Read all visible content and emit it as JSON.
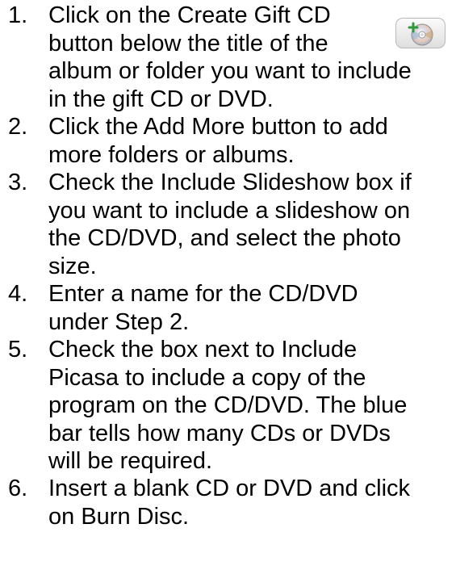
{
  "steps": [
    {
      "number": "1.",
      "lines": [
        "Click on the Create Gift CD",
        "button below the title of the",
        "album or folder you want to include",
        "in the gift CD or DVD."
      ]
    },
    {
      "number": "2.",
      "lines": [
        "Click the Add More button to add",
        "more folders or albums."
      ]
    },
    {
      "number": "3.",
      "lines": [
        "Check the Include Slideshow box if",
        "you want to include a slideshow on",
        "the CD/DVD, and select the photo",
        "size."
      ]
    },
    {
      "number": "4.",
      "lines": [
        "Enter a name for the CD/DVD",
        "under Step 2."
      ]
    },
    {
      "number": "5.",
      "lines": [
        "Check the box next to Include",
        "Picasa to include a copy of the",
        "program on the CD/DVD. The blue",
        "bar tells how many CDs or DVDs",
        "will be required."
      ]
    },
    {
      "number": "6.",
      "lines": [
        "Insert a blank CD or DVD and click",
        "on Burn Disc."
      ]
    }
  ],
  "icons": {
    "create_gift_cd": "cd-with-plus-icon"
  }
}
